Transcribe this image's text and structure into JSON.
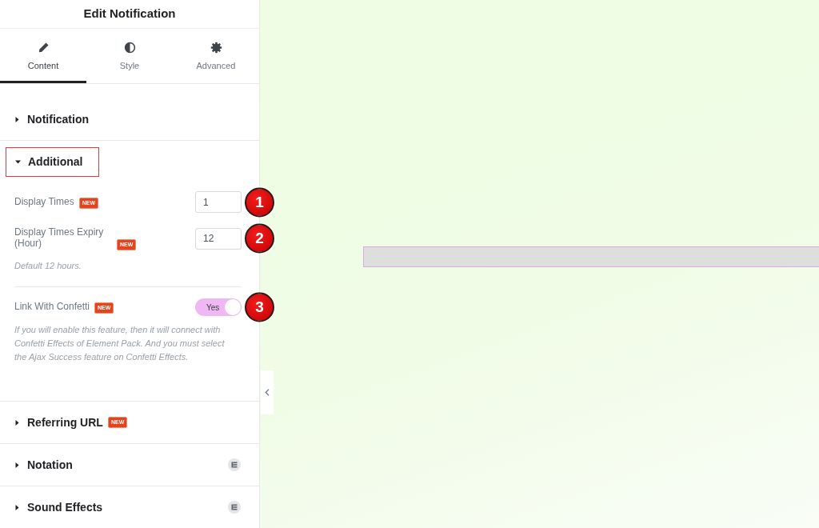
{
  "panel": {
    "title": "Edit Notification"
  },
  "tabs": [
    {
      "label": "Content",
      "selected": true
    },
    {
      "label": "Style",
      "selected": false
    },
    {
      "label": "Advanced",
      "selected": false
    }
  ],
  "sections": [
    {
      "title": "Notification",
      "expanded": false,
      "highlighted": false,
      "pro": false
    },
    {
      "title": "Additional",
      "expanded": true,
      "highlighted": true,
      "pro": false,
      "controls": [
        {
          "kind": "number",
          "label": "Display Times",
          "badge": "NEW",
          "value": "1",
          "marker": "1",
          "divider_before": false
        },
        {
          "kind": "number",
          "label": "Display Times Expiry (Hour)",
          "badge": "NEW",
          "value": "12",
          "hint": "Default 12 hours.",
          "marker": "2",
          "divider_before": false
        },
        {
          "kind": "toggle",
          "label": "Link With Confetti",
          "badge": "NEW",
          "on": true,
          "state_label": "Yes",
          "hint": "If you will enable this feature, then it will connect with Confetti Effects of Element Pack. And you must select the Ajax Success feature on Confetti Effects.",
          "marker": "3",
          "divider_before": true
        }
      ]
    },
    {
      "title": "Referring URL",
      "badge": "NEW",
      "expanded": false,
      "highlighted": false,
      "pro": false
    },
    {
      "title": "Notation",
      "expanded": false,
      "highlighted": false,
      "pro": true
    },
    {
      "title": "Sound Effects",
      "expanded": false,
      "highlighted": false,
      "pro": true
    }
  ]
}
